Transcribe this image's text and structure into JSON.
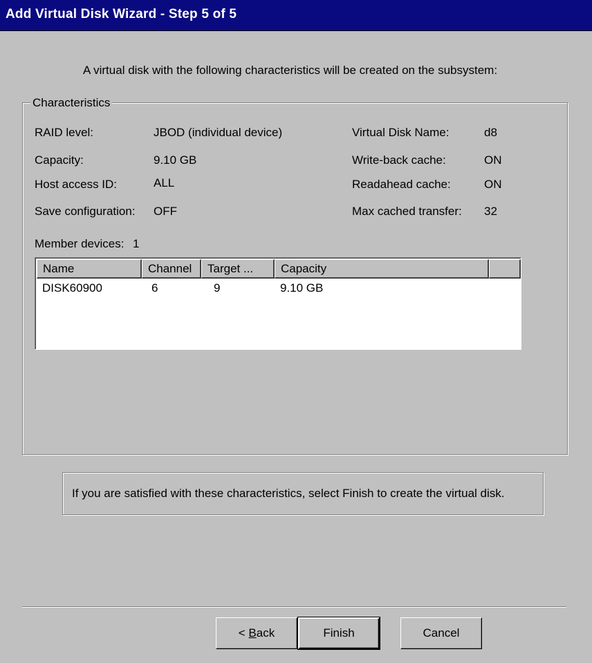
{
  "window": {
    "title": "Add Virtual Disk Wizard - Step 5 of 5"
  },
  "intro": "A virtual disk with the following characteristics will be created on the subsystem:",
  "characteristics": {
    "legend": "Characteristics",
    "left": [
      {
        "label": "RAID level:",
        "value": "JBOD (individual device)"
      },
      {
        "label": "Capacity:",
        "value": "9.10 GB"
      },
      {
        "label": "Host access ID:",
        "value": "ALL"
      },
      {
        "label": "Save configuration:",
        "value": "OFF"
      }
    ],
    "right": [
      {
        "label": "Virtual Disk Name:",
        "value": "d8"
      },
      {
        "label": "Write-back cache:",
        "value": "ON"
      },
      {
        "label": "Readahead cache:",
        "value": "ON"
      },
      {
        "label": "Max cached transfer:",
        "value": "32"
      }
    ],
    "member_devices": {
      "label": "Member devices:",
      "count": "1"
    },
    "table": {
      "columns": [
        "Name",
        "Channel",
        "Target ...",
        "Capacity",
        ""
      ],
      "rows": [
        [
          "DISK60900",
          "6",
          "9",
          "9.10 GB"
        ]
      ]
    }
  },
  "info": "If you are satisfied with these characteristics, select Finish to create the virtual disk.",
  "buttons": {
    "back_prefix": "< ",
    "back_mnemonic": "B",
    "back_rest": "ack",
    "finish": "Finish",
    "cancel": "Cancel"
  }
}
